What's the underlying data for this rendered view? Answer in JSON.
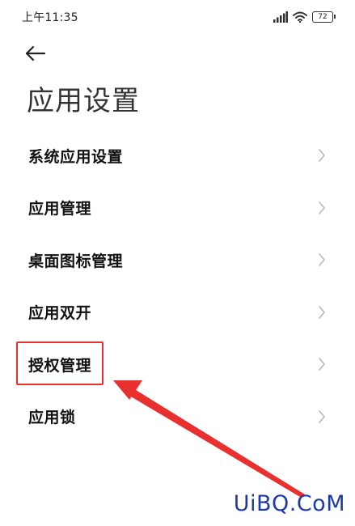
{
  "status_bar": {
    "time": "上午11:35",
    "battery": "72"
  },
  "page": {
    "title": "应用设置"
  },
  "settings": {
    "items": [
      {
        "label": "系统应用设置"
      },
      {
        "label": "应用管理"
      },
      {
        "label": "桌面图标管理"
      },
      {
        "label": "应用双开"
      },
      {
        "label": "授权管理"
      },
      {
        "label": "应用锁"
      }
    ]
  },
  "annotation": {
    "highlight_color": "#e8302f",
    "highlighted_item": "授权管理"
  },
  "watermark": {
    "text": "UiBQ.CoM",
    "color": "#1c3aa8"
  },
  "icons": {
    "back": "back-arrow-icon",
    "chevron": "chevron-right-icon",
    "signal": "signal-icon",
    "wifi": "wifi-icon",
    "battery": "battery-icon"
  }
}
